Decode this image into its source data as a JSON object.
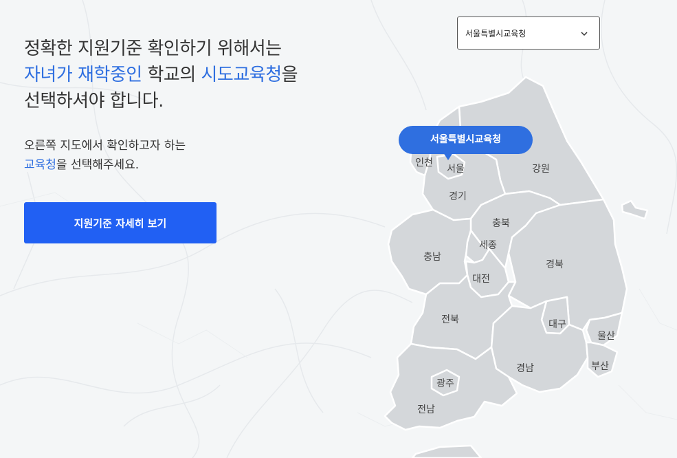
{
  "headline": {
    "line1": "정확한 지원기준 확인하기 위해서는",
    "line2_hl1": "자녀가 재학중인",
    "line2_mid": " 학교의 ",
    "line2_hl2": "시도교육청",
    "line2_end": "을",
    "line3": "선택하셔야 합니다."
  },
  "subtext": {
    "line1": "오른쪽 지도에서 확인하고자 하는",
    "line2_hl": "교육청",
    "line2_rest": "을 선택해주세요."
  },
  "cta_button": {
    "label": "지원기준 자세히 보기"
  },
  "office_select": {
    "selected": "서울특별시교육청",
    "icon": "chevron-down-icon"
  },
  "map": {
    "selected_bubble": "서울특별시교육청",
    "regions": {
      "incheon": "인천",
      "seoul": "서울",
      "gangwon": "강원",
      "gyeonggi": "경기",
      "chungbuk": "충북",
      "sejong": "세종",
      "chungnam": "충남",
      "gyeongbuk": "경북",
      "daejeon": "대전",
      "jeonbuk": "전북",
      "daegu": "대구",
      "ulsan": "울산",
      "gyeongnam": "경남",
      "busan": "부산",
      "gwangju": "광주",
      "jeonnam": "전남"
    }
  },
  "colors": {
    "accent": "#2f6fe0",
    "button": "#2160f3",
    "region_fill": "#d4d7da",
    "background": "#f4f6f7"
  }
}
